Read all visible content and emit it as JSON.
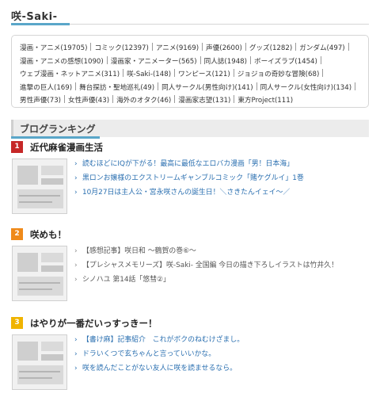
{
  "site": {
    "title": "咲-Saki-"
  },
  "tags": [
    "漫画・アニメ(19705)",
    "コミック(12397)",
    "アニメ(9169)",
    "声優(2600)",
    "グッズ(1282)",
    "ガンダム(497)",
    "漫画・アニメの感想(1090)",
    "漫画家・アニメーター(565)",
    "同人誌(1948)",
    "ボーイズラブ(1454)",
    "ウェブ漫画・ネットアニメ(311)",
    "咲-Saki-(148)",
    "ワンピース(121)",
    "ジョジョの奇妙な冒険(68)",
    "進撃の巨人(169)",
    "舞台探訪・聖地巡礼(49)",
    "同人サークル(男性向け)(141)",
    "同人サークル(女性向け)(134)",
    "男性声優(73)",
    "女性声優(43)",
    "海外のオタク(46)",
    "漫画家志望(131)",
    "東方Project(111)"
  ],
  "ranking": {
    "title": "ブログランキング",
    "blogs": [
      {
        "rank": "1",
        "badge_color": "#c62828",
        "name": "近代麻雀漫画生活",
        "entries": [
          {
            "text": "読むほどにIQが下がる！最高に最低なエロバカ漫画「男！日本海」",
            "style": "link"
          },
          {
            "text": "黒ロンお嬢様のエクストリームギャンブルコミック「賭ケグルイ」1巻",
            "style": "link"
          },
          {
            "text": "10月27日は主人公・宮永咲さんの誕生日！＼さきたんイェイ～／",
            "style": "link"
          }
        ]
      },
      {
        "rank": "2",
        "badge_color": "#ef8a1a",
        "name": "咲めも！",
        "entries": [
          {
            "text": "【感想記事】咲日和 ～鶴賀の巻⑥～",
            "style": "plain"
          },
          {
            "text": "【プレシャスメモリーズ】咲-Saki- 全国編 今日の描き下ろしイラストは竹井久！",
            "style": "plain"
          },
          {
            "text": "シノハユ 第14話「悠彗②」",
            "style": "plain"
          }
        ]
      },
      {
        "rank": "3",
        "badge_color": "#f0b400",
        "name": "はやりが一番だいっすっきー！",
        "entries": [
          {
            "text": "【書け麻】記事紹介　これがボクのねむけざまし。",
            "style": "link"
          },
          {
            "text": "ドラいくつで玄ちゃんと言っていいかな。",
            "style": "link"
          },
          {
            "text": "咲を読んだことがない友人に咲を読ませるなら。",
            "style": "link"
          }
        ]
      }
    ]
  }
}
